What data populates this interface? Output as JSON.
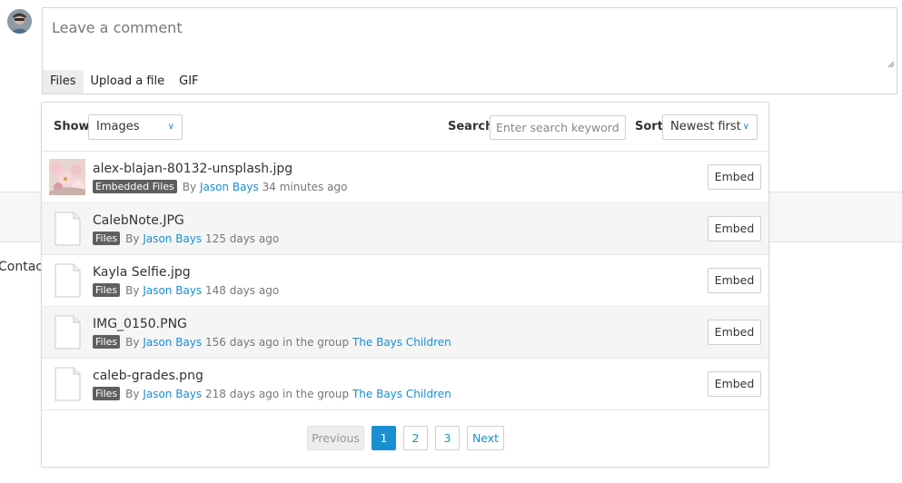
{
  "composer": {
    "placeholder": "Leave a comment",
    "tabs": [
      {
        "label": "Files",
        "active": true
      },
      {
        "label": "Upload a file",
        "active": false
      },
      {
        "label": "GIF",
        "active": false
      }
    ]
  },
  "background": {
    "contact_text": "Contact"
  },
  "filters": {
    "show_label": "Show",
    "show_value": "Images",
    "search_label": "Search",
    "search_placeholder": "Enter search keyword...",
    "sort_label": "Sort",
    "sort_value": "Newest first"
  },
  "files": [
    {
      "name": "alex-blajan-80132-unsplash.jpg",
      "badge": "Embedded Files",
      "by": "By",
      "author": "Jason Bays",
      "age": "34 minutes ago",
      "group_prefix": "",
      "group": "",
      "thumbnail": "photo-thumbnail",
      "embed": "Embed"
    },
    {
      "name": "CalebNote.JPG",
      "badge": "Files",
      "by": "By",
      "author": "Jason Bays",
      "age": "125 days ago",
      "group_prefix": "",
      "group": "",
      "thumbnail": "file-icon",
      "embed": "Embed"
    },
    {
      "name": "Kayla Selfie.jpg",
      "badge": "Files",
      "by": "By",
      "author": "Jason Bays",
      "age": "148 days ago",
      "group_prefix": "",
      "group": "",
      "thumbnail": "file-icon",
      "embed": "Embed"
    },
    {
      "name": "IMG_0150.PNG",
      "badge": "Files",
      "by": "By",
      "author": "Jason Bays",
      "age": "156 days ago",
      "group_prefix": "in the group",
      "group": "The Bays Children",
      "thumbnail": "file-icon",
      "embed": "Embed"
    },
    {
      "name": "caleb-grades.png",
      "badge": "Files",
      "by": "By",
      "author": "Jason Bays",
      "age": "218 days ago",
      "group_prefix": "in the group",
      "group": "The Bays Children",
      "thumbnail": "file-icon",
      "embed": "Embed"
    }
  ],
  "pagination": {
    "previous": "Previous",
    "pages": [
      "1",
      "2",
      "3"
    ],
    "current": "1",
    "next": "Next"
  },
  "colors": {
    "link": "#1a8fd1",
    "badge": "#5f5f5f",
    "active_page": "#1a8fd1"
  }
}
